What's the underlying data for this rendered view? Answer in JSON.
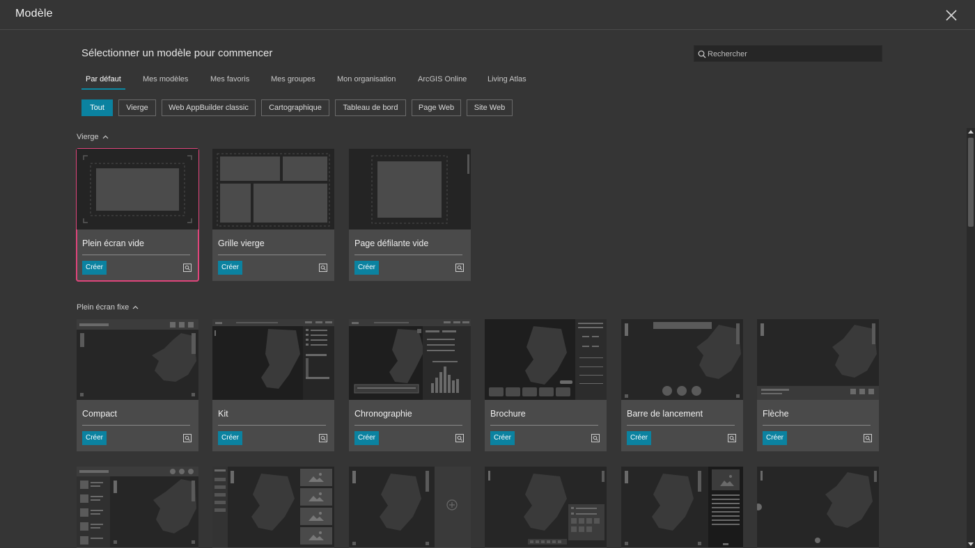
{
  "window": {
    "title": "Modèle"
  },
  "heading": "Sélectionner un modèle pour commencer",
  "search": {
    "placeholder": "Rechercher",
    "value": ""
  },
  "tabs": [
    "Par défaut",
    "Mes modèles",
    "Mes favoris",
    "Mes groupes",
    "Mon organisation",
    "ArcGIS Online",
    "Living Atlas"
  ],
  "active_tab": "Par défaut",
  "filters": [
    "Tout",
    "Vierge",
    "Web AppBuilder classic",
    "Cartographique",
    "Tableau de bord",
    "Page Web",
    "Site Web"
  ],
  "active_filter": "Tout",
  "sections": [
    {
      "title": "Vierge",
      "templates": [
        "Plein écran vide",
        "Grille vierge",
        "Page défilante vide"
      ]
    },
    {
      "title": "Plein écran fixe",
      "templates": [
        "Compact",
        "Kit",
        "Chronographie",
        "Brochure",
        "Barre de lancement",
        "Flèche"
      ]
    }
  ],
  "create_label": "Créer",
  "colors": {
    "accent": "#0b82a0",
    "selection": "#e0457b",
    "background": "#353535",
    "card": "#4a4a4a"
  },
  "icons": [
    "close-icon",
    "search-icon",
    "chevron-up-icon",
    "preview-icon",
    "plus-circle-icon",
    "image-icon"
  ]
}
